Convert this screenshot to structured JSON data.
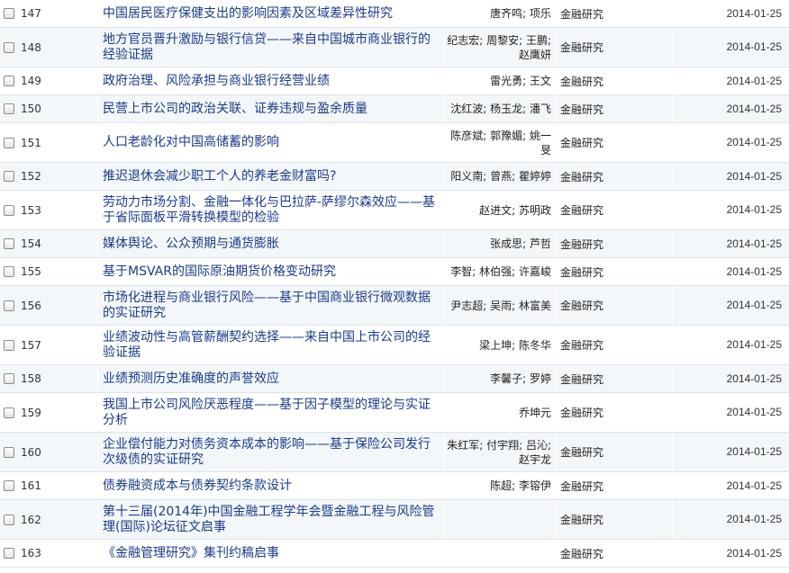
{
  "rows": [
    {
      "num": "147",
      "title": "中国居民医疗保健支出的影响因素及区域差异性研究",
      "authors": "唐齐鸣; 项乐",
      "source": "金融研究",
      "date": "2014-01-25"
    },
    {
      "num": "148",
      "title": "地方官员晋升激励与银行信贷——来自中国城市商业银行的经验证据",
      "authors": "纪志宏; 周黎安; 王鹏; 赵鹰妍",
      "source": "金融研究",
      "date": "2014-01-25"
    },
    {
      "num": "149",
      "title": "政府治理、风险承担与商业银行经营业绩",
      "authors": "雷光勇; 王文",
      "source": "金融研究",
      "date": "2014-01-25"
    },
    {
      "num": "150",
      "title": "民营上市公司的政治关联、证券违规与盈余质量",
      "authors": "沈红波; 杨玉龙; 潘飞",
      "source": "金融研究",
      "date": "2014-01-25"
    },
    {
      "num": "151",
      "title": "人口老龄化对中国高储蓄的影响",
      "authors": "陈彦斌; 郭豫媚; 姚一旻",
      "source": "金融研究",
      "date": "2014-01-25"
    },
    {
      "num": "152",
      "title": "推迟退休会减少职工个人的养老金财富吗?",
      "authors": "阳义南; 曾燕; 瞿婷婷",
      "source": "金融研究",
      "date": "2014-01-25"
    },
    {
      "num": "153",
      "title": "劳动力市场分割、金融一体化与巴拉萨-萨缪尔森效应——基于省际面板平滑转换模型的检验",
      "authors": "赵进文; 苏明政",
      "source": "金融研究",
      "date": "2014-01-25"
    },
    {
      "num": "154",
      "title": "媒体舆论、公众预期与通货膨胀",
      "authors": "张成思; 芦哲",
      "source": "金融研究",
      "date": "2014-01-25"
    },
    {
      "num": "155",
      "title": "基于MSVAR的国际原油期货价格变动研究",
      "authors": "李智; 林伯强; 许嘉峻",
      "source": "金融研究",
      "date": "2014-01-25"
    },
    {
      "num": "156",
      "title": "市场化进程与商业银行风险——基于中国商业银行微观数据的实证研究",
      "authors": "尹志超; 吴雨; 林富美",
      "source": "金融研究",
      "date": "2014-01-25"
    },
    {
      "num": "157",
      "title": "业绩波动性与高管薪酬契约选择——来自中国上市公司的经验证据",
      "authors": "梁上坤; 陈冬华",
      "source": "金融研究",
      "date": "2014-01-25"
    },
    {
      "num": "158",
      "title": "业绩预测历史准确度的声誉效应",
      "authors": "李馨子; 罗婷",
      "source": "金融研究",
      "date": "2014-01-25"
    },
    {
      "num": "159",
      "title": "我国上市公司风险厌恶程度——基于因子模型的理论与实证分析",
      "authors": "乔坤元",
      "source": "金融研究",
      "date": "2014-01-25"
    },
    {
      "num": "160",
      "title": "企业偿付能力对债务资本成本的影响——基于保险公司发行次级债的实证研究",
      "authors": "朱红军; 付宇翔; 吕沁; 赵宇龙",
      "source": "金融研究",
      "date": "2014-01-25"
    },
    {
      "num": "161",
      "title": "债券融资成本与债券契约条款设计",
      "authors": "陈超; 李镕伊",
      "source": "金融研究",
      "date": "2014-01-25"
    },
    {
      "num": "162",
      "title": "第十三届(2014年)中国金融工程学年会暨金融工程与风险管理(国际)论坛征文启事",
      "authors": "",
      "source": "金融研究",
      "date": "2014-01-25"
    },
    {
      "num": "163",
      "title": "《金融管理研究》集刊约稿启事",
      "authors": "",
      "source": "金融研究",
      "date": "2014-01-25"
    }
  ]
}
